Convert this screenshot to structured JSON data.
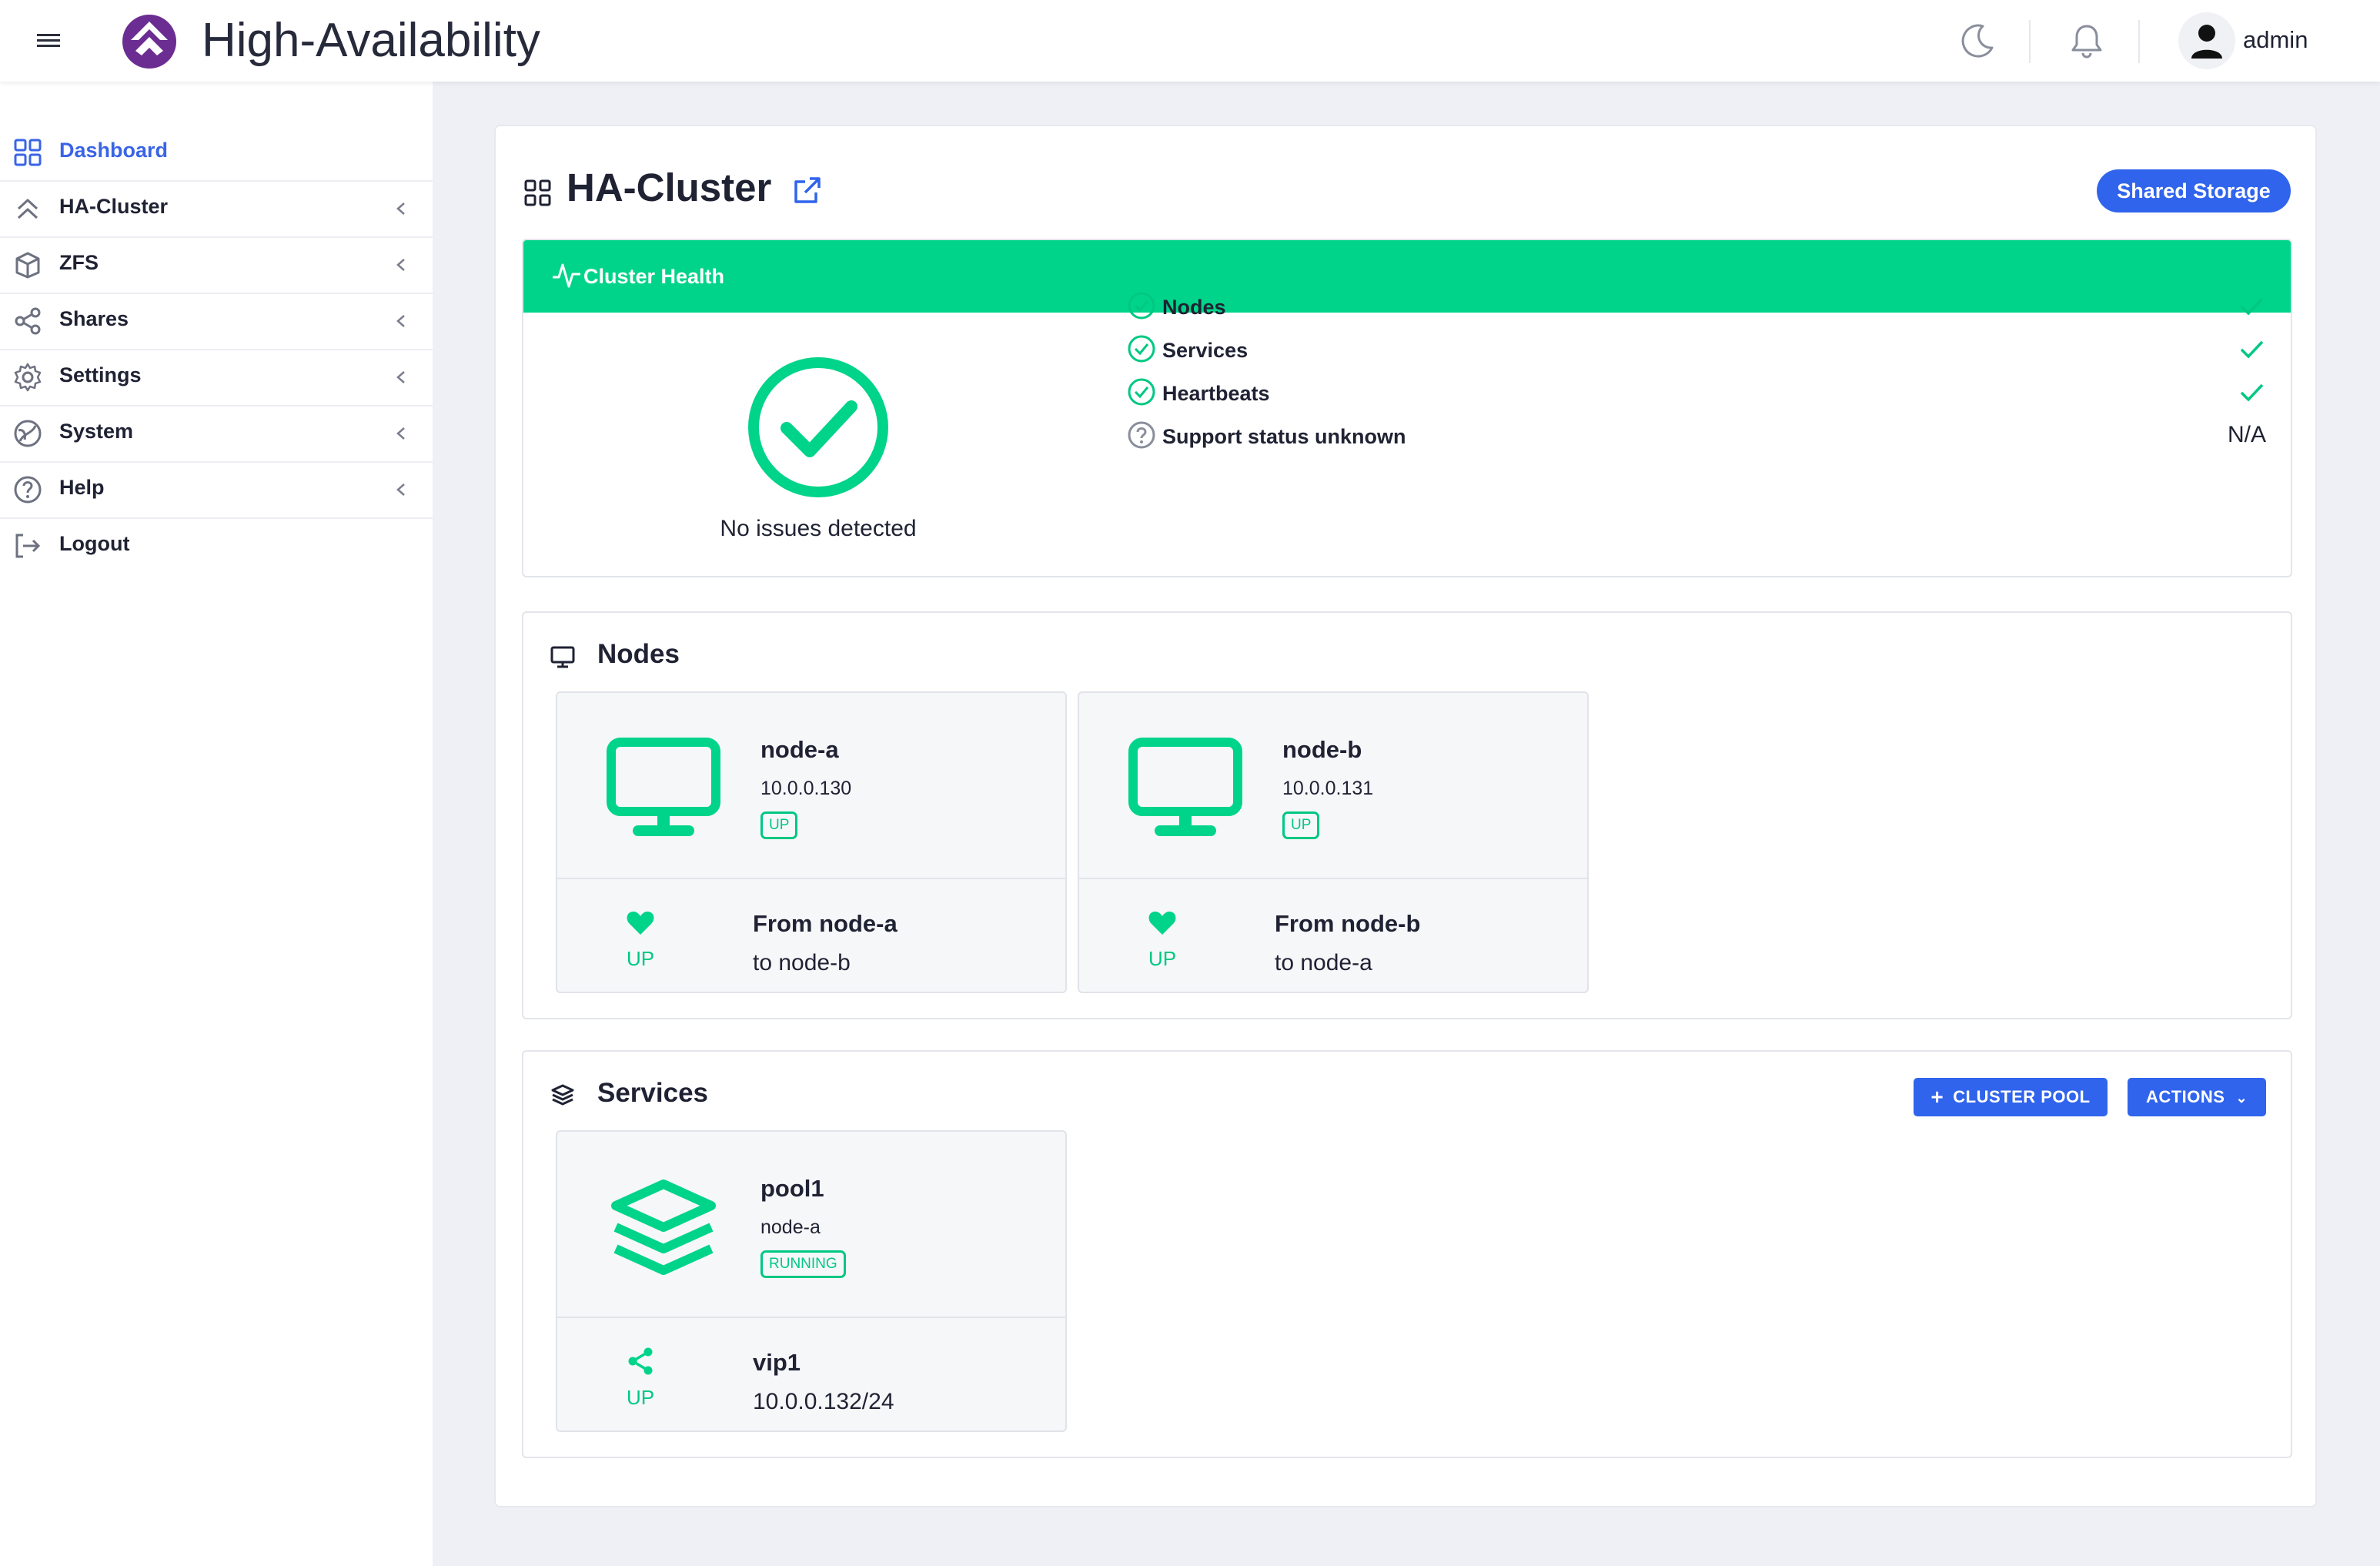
{
  "app": {
    "title": "High-Availability"
  },
  "header": {
    "user_name": "admin"
  },
  "sidebar": {
    "items": [
      {
        "label": "Dashboard",
        "icon": "grid-icon",
        "active": true
      },
      {
        "label": "HA-Cluster",
        "icon": "chevrons-up-icon"
      },
      {
        "label": "ZFS",
        "icon": "box-icon"
      },
      {
        "label": "Shares",
        "icon": "share-icon"
      },
      {
        "label": "Settings",
        "icon": "gear-icon"
      },
      {
        "label": "System",
        "icon": "system-icon"
      },
      {
        "label": "Help",
        "icon": "help-icon"
      },
      {
        "label": "Logout",
        "icon": "logout-icon"
      }
    ]
  },
  "page": {
    "title": "HA-Cluster",
    "shared_storage_label": "Shared Storage"
  },
  "health": {
    "title": "Cluster Health",
    "summary": "No issues detected",
    "checks": [
      {
        "label": "Nodes",
        "status": "ok"
      },
      {
        "label": "Services",
        "status": "ok"
      },
      {
        "label": "Heartbeats",
        "status": "ok"
      },
      {
        "label": "Support status unknown",
        "status": "N/A"
      }
    ]
  },
  "nodes": {
    "title": "Nodes",
    "items": [
      {
        "name": "node-a",
        "ip": "10.0.0.130",
        "status": "UP",
        "hb_status": "UP",
        "hb_from": "From node-a",
        "hb_to": "to node-b"
      },
      {
        "name": "node-b",
        "ip": "10.0.0.131",
        "status": "UP",
        "hb_status": "UP",
        "hb_from": "From node-b",
        "hb_to": "to node-a"
      }
    ]
  },
  "services": {
    "title": "Services",
    "cluster_pool_label": "CLUSTER POOL",
    "actions_label": "ACTIONS",
    "items": [
      {
        "name": "pool1",
        "node": "node-a",
        "status": "RUNNING",
        "vip_status": "UP",
        "vip_name": "vip1",
        "vip_addr": "10.0.0.132/24"
      }
    ]
  },
  "colors": {
    "accent": "#3064ec",
    "success": "#00d48a",
    "brand": "#6b2d91"
  }
}
